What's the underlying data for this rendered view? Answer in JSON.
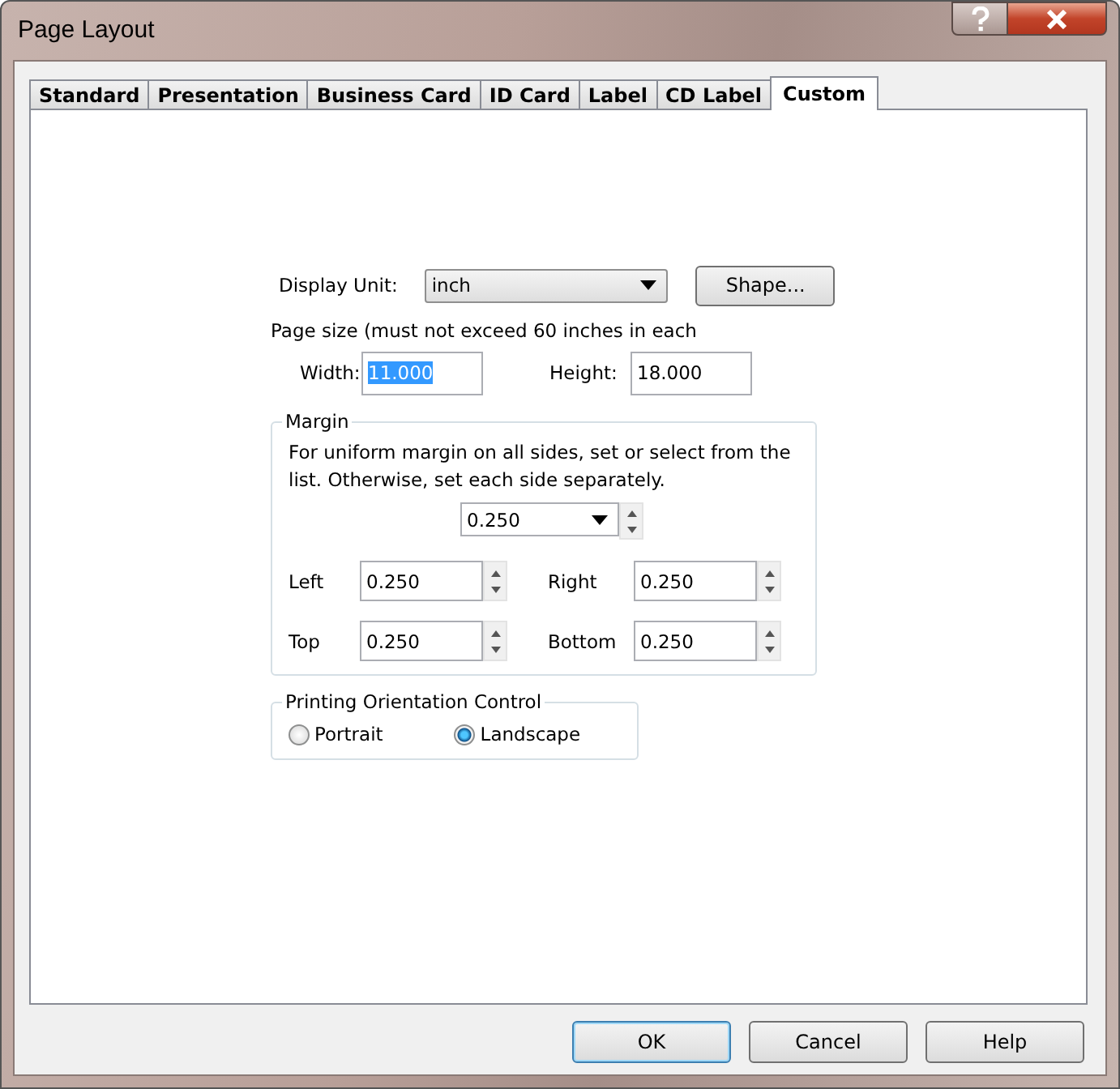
{
  "window": {
    "title": "Page Layout"
  },
  "tabs": [
    {
      "label": "Standard",
      "selected": false
    },
    {
      "label": "Presentation",
      "selected": false
    },
    {
      "label": "Business Card",
      "selected": false
    },
    {
      "label": "ID Card",
      "selected": false
    },
    {
      "label": "Label",
      "selected": false
    },
    {
      "label": "CD Label",
      "selected": false
    },
    {
      "label": "Custom",
      "selected": true
    }
  ],
  "display_unit": {
    "label": "Display Unit:",
    "value": "inch"
  },
  "shape_button": "Shape...",
  "page_size_note": "Page size (must not exceed 60 inches in each",
  "width": {
    "label": "Width:",
    "value": "11.000",
    "text_selected": true
  },
  "height": {
    "label": "Height:",
    "value": "18.000",
    "text_selected": false
  },
  "margin": {
    "title": "Margin",
    "instructions": "For uniform margin on all sides, set or select from the list.  Otherwise, set each side separately.",
    "uniform_value": "0.250",
    "sides": [
      {
        "label": "Left",
        "value": "0.250"
      },
      {
        "label": "Right",
        "value": "0.250"
      },
      {
        "label": "Top",
        "value": "0.250"
      },
      {
        "label": "Bottom",
        "value": "0.250"
      }
    ]
  },
  "orientation": {
    "title": "Printing Orientation Control",
    "options": [
      {
        "label": "Portrait",
        "selected": false
      },
      {
        "label": "Landscape",
        "selected": true
      }
    ]
  },
  "buttons": [
    {
      "label": "OK",
      "default": true
    },
    {
      "label": "Cancel",
      "default": false
    },
    {
      "label": "Help",
      "default": false
    }
  ]
}
